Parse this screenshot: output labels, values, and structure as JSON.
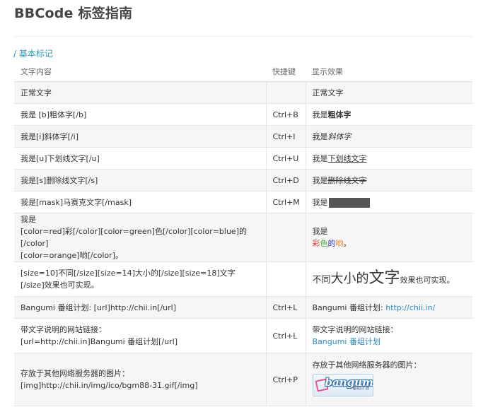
{
  "page": {
    "title": "BBCode 标签指南",
    "section_link": "/ 基本标记"
  },
  "table": {
    "headers": {
      "content": "文字内容",
      "shortcut": "快捷键",
      "effect": "显示效果"
    },
    "rows": {
      "normal": {
        "content": "正常文字",
        "shortcut": "",
        "effect": "正常文字"
      },
      "bold": {
        "content": "我是 [b]粗体字[/b]",
        "shortcut": "Ctrl+B",
        "effect_prefix": "我是",
        "effect_styled": "粗体字"
      },
      "italic": {
        "content": "我是[i]斜体字[/i]",
        "shortcut": "Ctrl+I",
        "effect_prefix": "我是",
        "effect_styled": "斜体字"
      },
      "underline": {
        "content": "我是[u]下划线文字[/u]",
        "shortcut": "Ctrl+U",
        "effect_prefix": "我是",
        "effect_styled": "下划线文字"
      },
      "strike": {
        "content": "我是[s]删除线文字[/s]",
        "shortcut": "Ctrl+D",
        "effect_prefix": "我是",
        "effect_styled": "删除线文字"
      },
      "mask": {
        "content": "我是[mask]马赛克文字[/mask]",
        "shortcut": "Ctrl+M",
        "effect_prefix": "我是"
      },
      "color": {
        "content_line1": "我是",
        "content_line2": "[color=red]彩[/color][color=green]色[/color][color=blue]的[/color]",
        "content_line3": "[color=orange]哟[/color]。",
        "shortcut": "",
        "effect_line1": "我是",
        "effect_c1": "彩",
        "effect_c2": "色",
        "effect_c3": "的",
        "effect_c4": "哟",
        "effect_end": "。"
      },
      "size": {
        "content": "[size=10]不同[/size][size=14]大小的[/size][size=18]文字[/size]效果也可实现。",
        "shortcut": "",
        "effect_s1": "不同",
        "effect_s2": "大小的",
        "effect_s3": "文字",
        "effect_tail": "效果也可实现。"
      },
      "url": {
        "content": "Bangumi 番组计划: [url]http://chii.in[/url]",
        "shortcut": "Ctrl+L",
        "effect_prefix": "Bangumi 番组计划: ",
        "effect_link": "http://chii.in/"
      },
      "url_desc": {
        "content_line1": "带文字说明的网站链接：",
        "content_line2": "[url=http://chii.in]Bangumi 番组计划[/url]",
        "shortcut": "Ctrl+L",
        "effect_line1": "带文字说明的网站链接：",
        "effect_link": "Bangumi 番组计划"
      },
      "img": {
        "content_line1": "存放于其他网络服务器的图片：",
        "content_line2": "[img]http://chii.in/img/ico/bgm88-31.gif[/img]",
        "shortcut": "Ctrl+P",
        "effect_line1": "存放于其他网络服务器的图片：",
        "logo_word": "bangumi",
        "logo_sub": "番组计划"
      }
    }
  },
  "colors": {
    "accent": "#2b9bb8",
    "link": "#2b8bc8",
    "red": "#dd3333",
    "green": "#33aa33",
    "blue": "#3333cc",
    "orange": "#e88a1a"
  },
  "icons": {
    "logo": "bangumi-logo-image"
  }
}
